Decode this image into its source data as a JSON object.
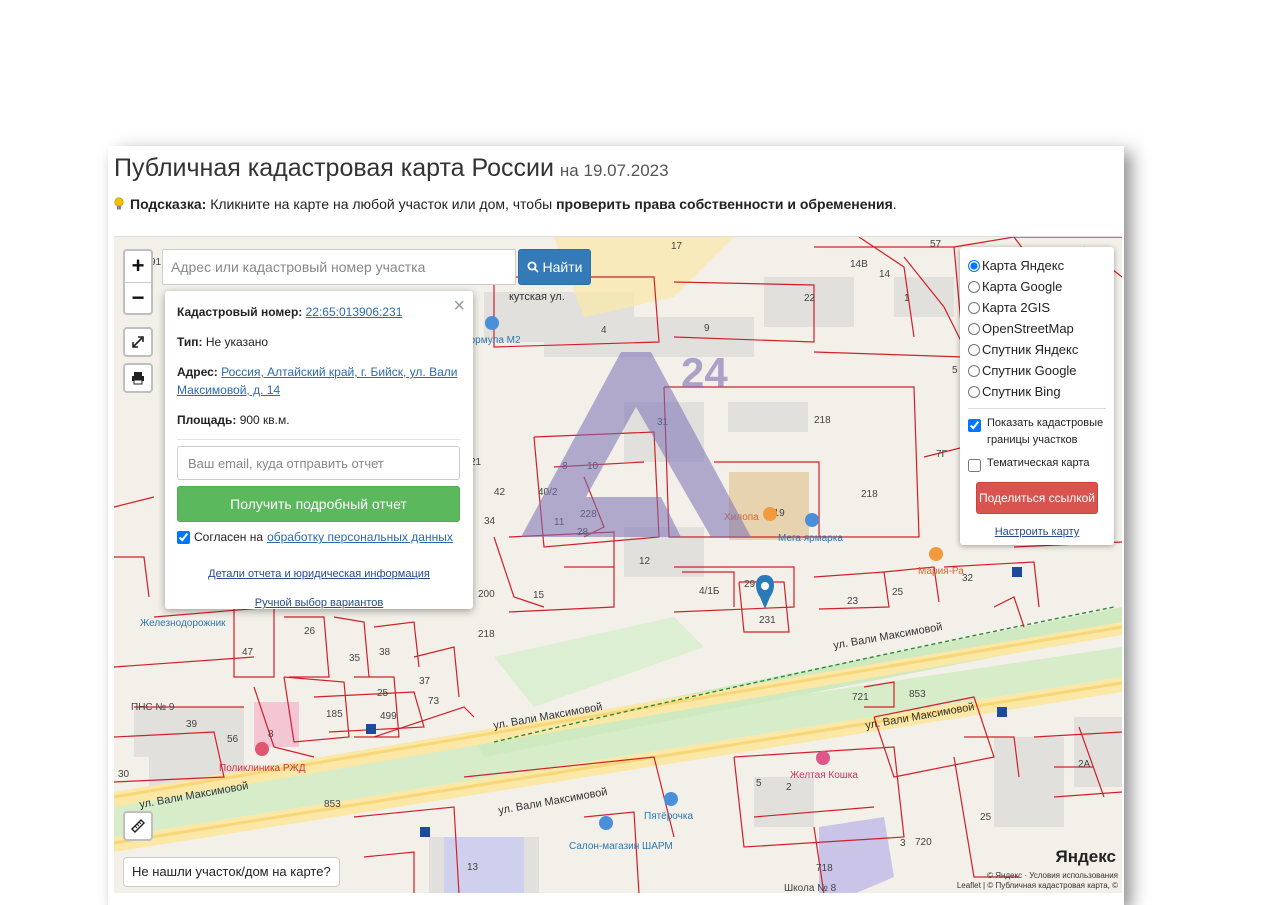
{
  "page": {
    "title": "Публичная кадастровая карта России",
    "date": "на 19.07.2023",
    "hint_label": "Подсказка:",
    "hint_text": "Кликните на карте на любой участок или дом, чтобы",
    "hint_bold": "проверить права собственности и обременения",
    "hint_end": "."
  },
  "map_controls": {
    "zoom_in": "+",
    "zoom_out": "−"
  },
  "search": {
    "placeholder": "Адрес или кадастровый номер участка",
    "button_label": "Найти"
  },
  "popup": {
    "cadastral_label": "Кадастровый номер:",
    "cadastral_value": "22:65:013906:231",
    "type_label": "Тип:",
    "type_value": "Не указано",
    "address_label": "Адрес:",
    "address_value": "Россия, Алтайский край, г. Бийск, ул. Вали Максимовой, д. 14",
    "area_label": "Площадь:",
    "area_value": "900 кв.м.",
    "email_placeholder": "Ваш email, куда отправить отчет",
    "report_button": "Получить подробный отчет",
    "agree_text": "Согласен на",
    "agree_link": "обработку персональных данных",
    "details_link": "Детали отчета и юридическая информация",
    "manual_link": "Ручной выбор вариантов",
    "close": "×"
  },
  "layers": {
    "options": [
      "Карта Яндекс",
      "Карта Google",
      "Карта 2GIS",
      "OpenStreetMap",
      "Спутник Яндекс",
      "Спутник Google",
      "Спутник Bing"
    ],
    "selected": "Карта Яндекс",
    "show_borders": "Показать кадастровые границы участков",
    "thematic": "Тематическая карта",
    "share_button": "Поделиться ссылкой",
    "configure_link": "Настроить карту"
  },
  "not_found_button": "Не нашли участок/дом на карте?",
  "attribution_line1": "© Яндекс · Условия использования",
  "attribution_line2": "Leaflet | © Публичная кадастровая карта, ©",
  "yandex_logo": "Яндекс",
  "watermark_text": "24",
  "map_labels": {
    "street1": "ул. Вали Максимовой",
    "street2": "ул. Вали Максимовой",
    "street3": "ул. Вали Максимовой",
    "street4": "ул. Вали Максимовой",
    "street5": "ул. Вали Максимовой",
    "street_top": "кутская ул.",
    "poi_formula": "Формула М2",
    "poi_hilopa": "Хилопа",
    "poi_mega": "Мега ярмарка",
    "poi_zheleznodorozhnik": "Железнодорожник",
    "poi_polyclinic": "Поликлиника РЖД",
    "poi_pns": "ПНС № 9",
    "poi_pyaterochka": "Пятёрочка",
    "poi_salon": "Салон-магазин ШАРМ",
    "poi_koshka": "Желтая Кошка",
    "poi_mariya": "Мария-Ра",
    "poi_school": "Школа № 8",
    "parcel_marker": "231",
    "nums": [
      "4",
      "9",
      "22",
      "14",
      "1",
      "31",
      "218",
      "219",
      "218",
      "12",
      "4/1Б",
      "29",
      "23",
      "25",
      "32",
      "8",
      "10",
      "11",
      "228",
      "28",
      "34",
      "40/2",
      "42",
      "21",
      "15",
      "200",
      "218",
      "47",
      "26",
      "35",
      "38",
      "37",
      "25",
      "73",
      "185",
      "499",
      "39",
      "8",
      "56",
      "853",
      "721",
      "853",
      "5",
      "2",
      "13",
      "718",
      "720",
      "3",
      "2А",
      "25",
      "30",
      "32",
      "17",
      "57",
      "14В",
      "5",
      "7Г",
      "91"
    ]
  }
}
